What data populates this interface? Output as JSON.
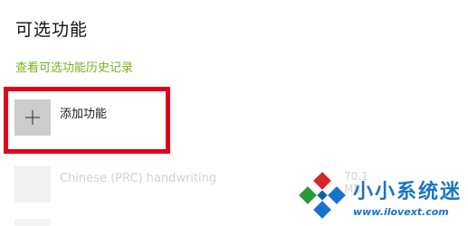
{
  "page_title": "可选功能",
  "history_link": "查看可选功能历史记录",
  "add_feature": {
    "label": "添加功能",
    "icon": "plus-icon"
  },
  "features": [
    {
      "name": "Chinese (PRC) handwriting",
      "size": "70.1 MB",
      "icon": "feature-icon"
    }
  ],
  "watermark": {
    "title": "小小系统迷",
    "url": "www.ilovext.com"
  },
  "colors": {
    "link": "#76b21f",
    "highlight": "#e0001b",
    "tile": "#cccccc",
    "watermark": "#1a73c9"
  }
}
